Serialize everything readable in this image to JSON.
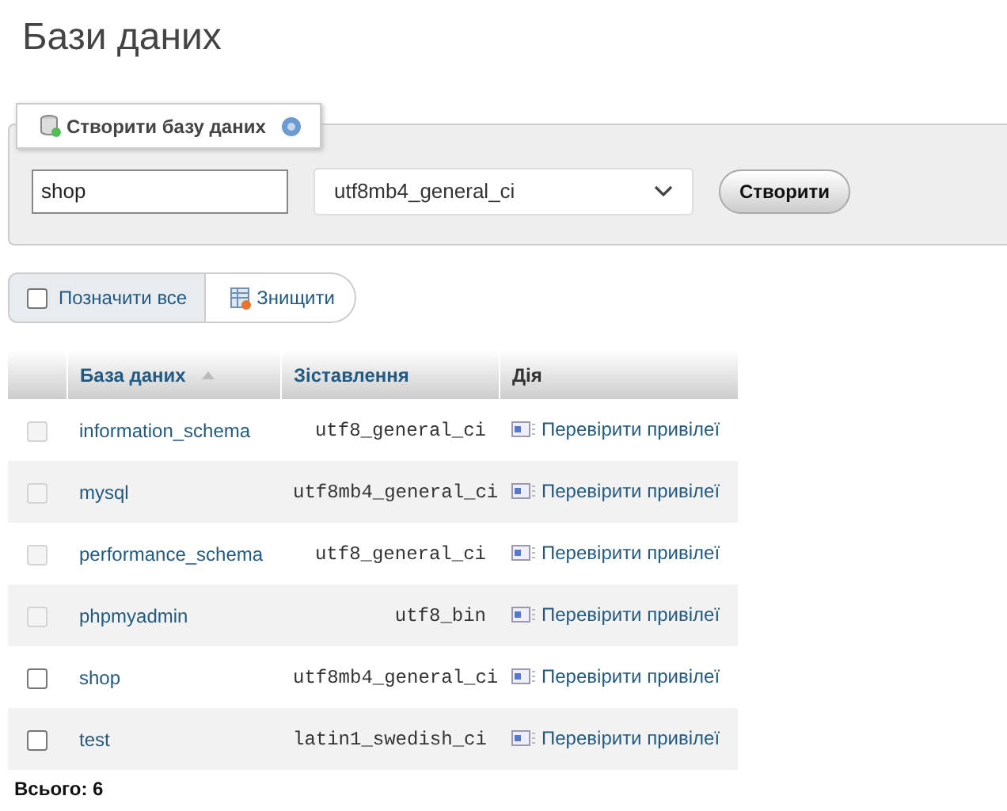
{
  "title": "Бази даних",
  "create": {
    "legend": "Створити базу даних",
    "name_value": "shop",
    "collation_value": "utf8mb4_general_ci",
    "button": "Створити"
  },
  "bulk": {
    "check_all": {
      "label": "Позначити все",
      "checked": false
    },
    "drop_button": "Знищити"
  },
  "table": {
    "columns": [
      {
        "label": "База даних",
        "sorted": true
      },
      {
        "label": "Зіставлення",
        "sorted": false
      },
      {
        "label": "Дія",
        "sorted": false
      }
    ],
    "rows": [
      {
        "name": "information_schema",
        "collation": "utf8_general_ci",
        "action": "Перевірити привілеї",
        "checked": false,
        "disabled": true
      },
      {
        "name": "mysql",
        "collation": "utf8mb4_general_ci",
        "action": "Перевірити привілеї",
        "checked": false,
        "disabled": true
      },
      {
        "name": "performance_schema",
        "collation": "utf8_general_ci",
        "action": "Перевірити привілеї",
        "checked": false,
        "disabled": true
      },
      {
        "name": "phpmyadmin",
        "collation": "utf8_bin",
        "action": "Перевірити привілеї",
        "checked": false,
        "disabled": true
      },
      {
        "name": "shop",
        "collation": "utf8mb4_general_ci",
        "action": "Перевірити привілеї",
        "checked": false,
        "disabled": false
      },
      {
        "name": "test",
        "collation": "latin1_swedish_ci",
        "action": "Перевірити привілеї",
        "checked": false,
        "disabled": false
      }
    ],
    "footer": "Всього: 6"
  }
}
